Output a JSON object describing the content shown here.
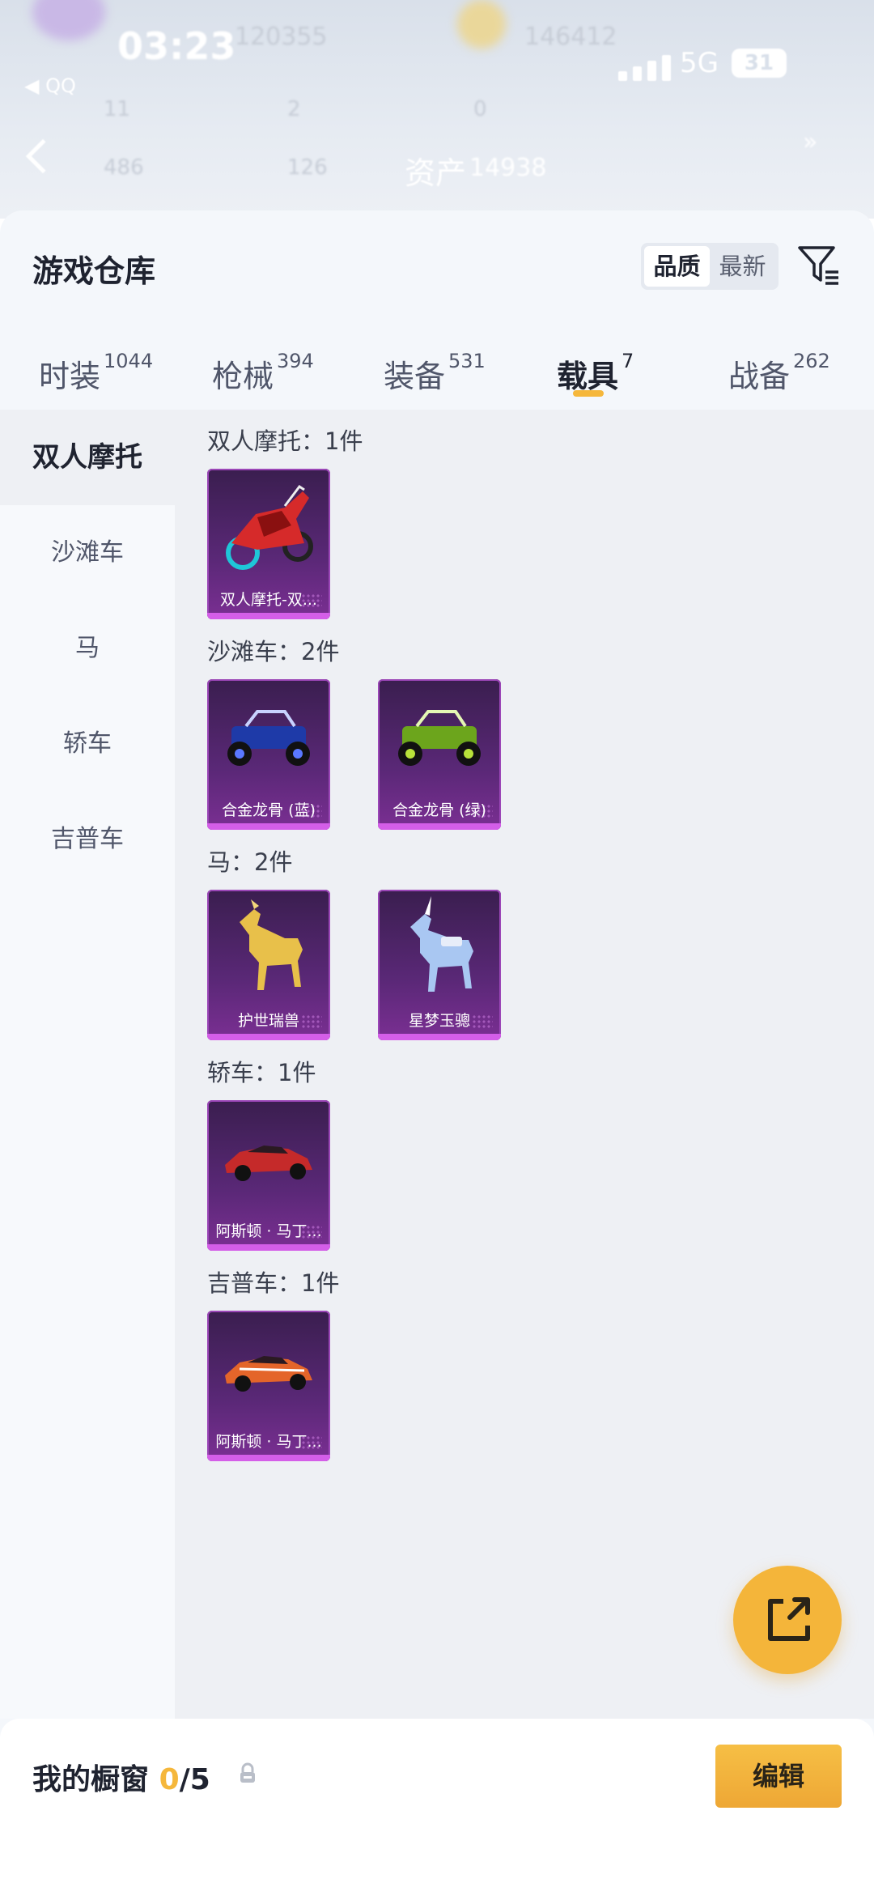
{
  "status_bar": {
    "time": "03:23",
    "back_app": "◀ QQ",
    "network": "5G",
    "battery": "31"
  },
  "header_bg": {
    "asset_label": "资产",
    "asset_value": "14938",
    "stat_a": "120355",
    "stat_b": "146412",
    "count_1": "11",
    "count_2": "2",
    "count_3": "0",
    "count_4": "486",
    "count_5": "126"
  },
  "sheet": {
    "title": "游戏仓库",
    "sort_options": [
      "品质",
      "最新"
    ],
    "active_sort": "品质"
  },
  "tabs": [
    {
      "label": "时装",
      "count": "1044"
    },
    {
      "label": "枪械",
      "count": "394"
    },
    {
      "label": "装备",
      "count": "531"
    },
    {
      "label": "载具",
      "count": "7"
    },
    {
      "label": "战备",
      "count": "262"
    }
  ],
  "active_tab": "载具",
  "sidebar": [
    "双人摩托",
    "沙滩车",
    "马",
    "轿车",
    "吉普车"
  ],
  "active_category": "双人摩托",
  "sections": [
    {
      "title": "双人摩托：1件",
      "items": [
        {
          "name": "双人摩托-双...",
          "art": "motorcycle-red"
        }
      ]
    },
    {
      "title": "沙滩车：2件",
      "items": [
        {
          "name": "合金龙骨 (蓝)",
          "art": "buggy-blue"
        },
        {
          "name": "合金龙骨 (绿)",
          "art": "buggy-green"
        }
      ]
    },
    {
      "title": "马：2件",
      "items": [
        {
          "name": "护世瑞兽",
          "art": "horse-gold"
        },
        {
          "name": "星梦玉骢",
          "art": "unicorn-crystal"
        }
      ]
    },
    {
      "title": "轿车：1件",
      "items": [
        {
          "name": "阿斯顿 · 马丁...",
          "art": "car-red"
        }
      ]
    },
    {
      "title": "吉普车：1件",
      "items": [
        {
          "name": "阿斯顿 · 马丁...",
          "art": "car-orange"
        }
      ]
    }
  ],
  "showcase": {
    "label": "我的橱窗",
    "current": "0",
    "total": "/5"
  },
  "edit_button": "编辑",
  "colors": {
    "accent": "#f5b73b",
    "card_purple": "#5a2877",
    "card_glow": "#d45ee8"
  }
}
